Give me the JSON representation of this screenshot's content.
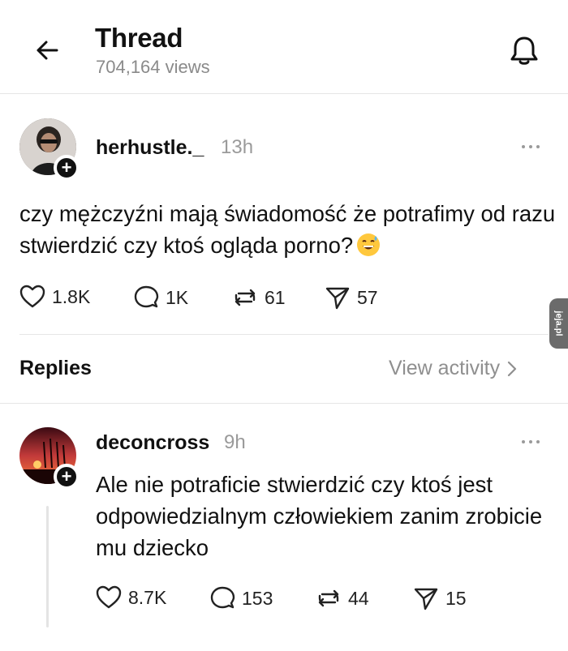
{
  "header": {
    "title": "Thread",
    "views": "704,164 views",
    "back_icon": "arrow-left-icon",
    "bell_icon": "bell-icon"
  },
  "post": {
    "username": "herhustle._",
    "time": "13h",
    "text": "czy mężczyźni mają świadomość że potrafimy od razu stwierdzić czy ktoś ogląda porno?",
    "emoji_icon": "grinning-sweat-emoji-icon",
    "likes": "1.8K",
    "comments": "1K",
    "reposts": "61",
    "shares": "57"
  },
  "replies_bar": {
    "label": "Replies",
    "view_activity": "View activity"
  },
  "reply": {
    "username": "deconcross",
    "time": "9h",
    "text": "Ale nie potraficie stwierdzić czy ktoś jest odpowiedzialnym człowiekiem zanim zrobicie mu dziecko",
    "likes": "8.7K",
    "comments": "153",
    "reposts": "44",
    "shares": "15"
  },
  "watermark": {
    "text": "jeja.pl"
  },
  "colors": {
    "text": "#111111",
    "muted": "#8a8a8a",
    "divider": "#e6e6e6"
  }
}
